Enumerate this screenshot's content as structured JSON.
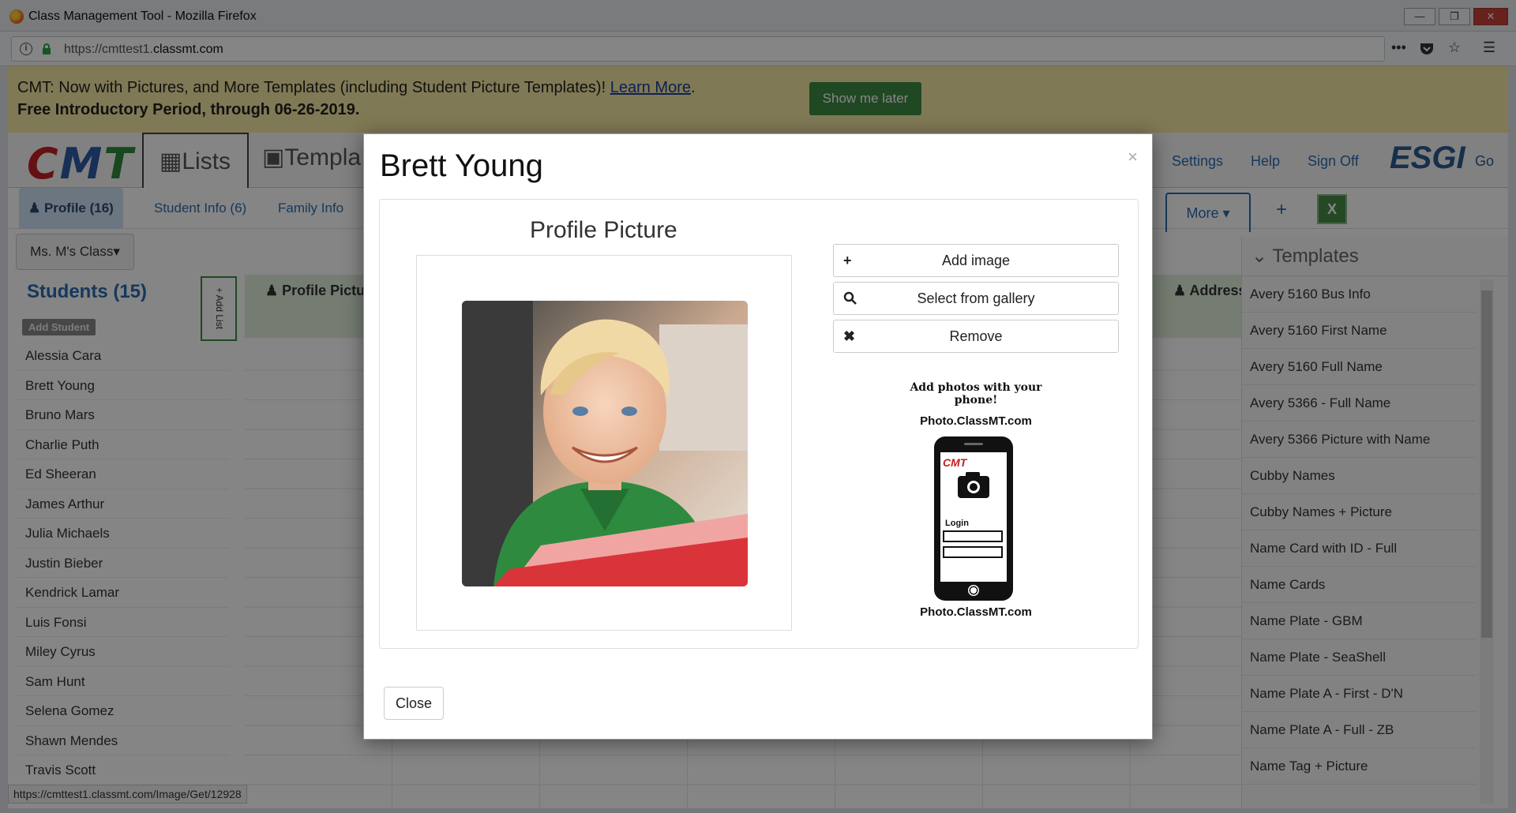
{
  "browser": {
    "window_title": "Class Management Tool - Mozilla Firefox",
    "url_prefix": "https://cmttest1.",
    "url_host": "classmt.com",
    "status_url": "https://cmttest1.classmt.com/Image/Get/12928"
  },
  "banner": {
    "line1_text": "CMT: Now with Pictures, and More Templates (including Student Picture Templates)! ",
    "learn_more": "Learn More",
    "line1_end": ".",
    "line2": "Free Introductory Period, through 06-26-2019.",
    "show_later": "Show me later"
  },
  "nav": {
    "logo": [
      "C",
      "M",
      "T"
    ],
    "lists_tab": "Lists",
    "templates_tab": "Templa",
    "settings": "Settings",
    "help": "Help",
    "sign_off": "Sign Off",
    "esgi": "ESGI",
    "go": "Go"
  },
  "subtabs": {
    "profile": "Profile (16)",
    "student_info": "Student Info (6)",
    "family_info": "Family Info",
    "more": "More",
    "plus": "+",
    "excel": "X"
  },
  "class_select": "Ms. M's Class",
  "students": {
    "title": "Students (15)",
    "add_student": "Add Student",
    "add_list": "+ Add List",
    "items": [
      "Alessia Cara",
      "Brett Young",
      "Bruno Mars",
      "Charlie Puth",
      "Ed Sheeran",
      "James Arthur",
      "Julia Michaels",
      "Justin Bieber",
      "Kendrick Lamar",
      "Luis Fonsi",
      "Miley Cyrus",
      "Sam Hunt",
      "Selena Gomez",
      "Shawn Mendes",
      "Travis Scott"
    ]
  },
  "grid": {
    "col_profile": "Profile Picture",
    "col_address": "Address"
  },
  "templates": {
    "title": "Templates",
    "items": [
      "Avery 5160 Bus Info",
      "Avery 5160 First Name",
      "Avery 5160 Full Name",
      "Avery 5366 - Full Name",
      "Avery 5366 Picture with Name",
      "Cubby Names",
      "Cubby Names + Picture",
      "Name Card with ID - Full",
      "Name Cards",
      "Name Plate - GBM",
      "Name Plate - SeaShell",
      "Name Plate A - First - D'N",
      "Name Plate A - Full - ZB",
      "Name Tag + Picture"
    ]
  },
  "modal": {
    "title": "Brett Young",
    "close_x": "×",
    "section_title": "Profile Picture",
    "add_image": "Add image",
    "select_gallery": "Select from gallery",
    "remove": "Remove",
    "phone_promo": "Add photos with your phone!",
    "phone_site_top": "Photo.ClassMT.com",
    "phone_site_bottom": "Photo.ClassMT.com",
    "phone_logo": "CMT",
    "phone_login": "Login",
    "close_button": "Close"
  },
  "colors": {
    "banner_bg": "#f5e9a4",
    "show_later_bg": "#3e8a42",
    "link_blue": "#2b6cb0",
    "overlay": "rgba(0,0,0,0.48)"
  }
}
